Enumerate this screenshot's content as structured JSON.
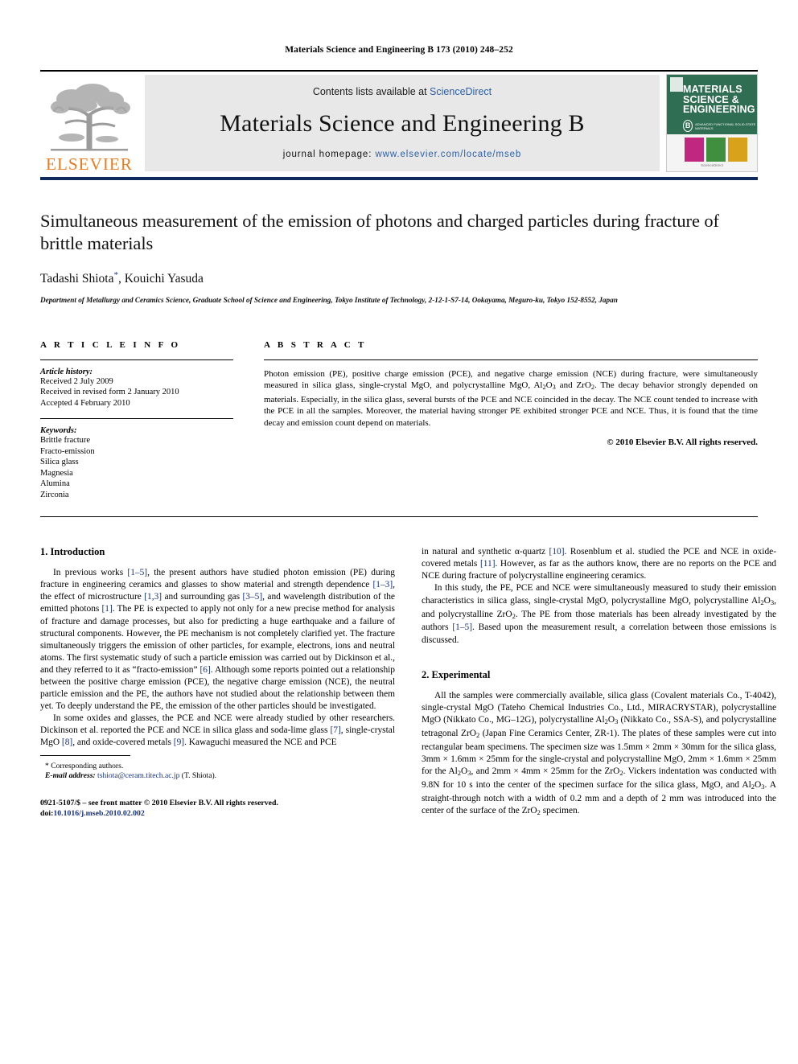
{
  "running_head": "Materials Science and Engineering B 173 (2010) 248–252",
  "masthead": {
    "publisher_name": "ELSEVIER",
    "contents_prefix": "Contents lists available at ",
    "contents_link": "ScienceDirect",
    "journal_title": "Materials Science and Engineering B",
    "homepage_prefix": "journal homepage: ",
    "homepage_url": "www.elsevier.com/locate/mseb",
    "cover": {
      "line1": "MATERIALS",
      "line2": "SCIENCE &",
      "line3": "ENGINEERING",
      "badge_letter": "B",
      "badge_text": "ADVANCED FUNCTIONAL SOLID-STATE MATERIALS",
      "footer_text": "ScienceDirect"
    }
  },
  "article": {
    "title": "Simultaneous measurement of the emission of photons and charged particles during fracture of brittle materials",
    "authors": "Tadashi Shiota",
    "authors_star": "*",
    "authors_rest": ", Kouichi Yasuda",
    "affiliation": "Department of Metallurgy and Ceramics Science, Graduate School of Science and Engineering, Tokyo Institute of Technology, 2-12-1-S7-14, Ookayama, Meguro-ku, Tokyo 152-8552, Japan"
  },
  "article_info": {
    "heading": "A R T I C L E  I N F O",
    "history_label": "Article history:",
    "history": [
      "Received 2 July 2009",
      "Received in revised form 2 January 2010",
      "Accepted 4 February 2010"
    ],
    "keywords_label": "Keywords:",
    "keywords": [
      "Brittle fracture",
      "Fracto-emission",
      "Silica glass",
      "Magnesia",
      "Alumina",
      "Zirconia"
    ]
  },
  "abstract": {
    "heading": "A B S T R A C T",
    "text_part1": "Photon emission (PE), positive charge emission (PCE), and negative charge emission (NCE) during fracture, were simultaneously measured in silica glass, single-crystal MgO, and polycrystalline MgO, Al",
    "text_part2": "O",
    "text_part3": " and ZrO",
    "text_part4": ". The decay behavior strongly depended on materials. Especially, in the silica glass, several bursts of the PCE and NCE coincided in the decay. The NCE count tended to increase with the PCE in all the samples. Moreover, the material having stronger PE exhibited stronger PCE and NCE. Thus, it is found that the time decay and emission count depend on materials.",
    "copyright": "© 2010 Elsevier B.V. All rights reserved."
  },
  "sections": {
    "introduction_heading": "1.  Introduction",
    "intro_p1_a": "In previous works ",
    "intro_p1_r1": "[1–5]",
    "intro_p1_b": ", the present authors have studied photon emission (PE) during fracture in engineering ceramics and glasses to show material and strength dependence ",
    "intro_p1_r2": "[1–3]",
    "intro_p1_c": ", the effect of microstructure ",
    "intro_p1_r3": "[1,3]",
    "intro_p1_d": " and surrounding gas ",
    "intro_p1_r4": "[3–5]",
    "intro_p1_e": ", and wavelength distribution of the emitted photons ",
    "intro_p1_r5": "[1]",
    "intro_p1_f": ". The PE is expected to apply not only for a new precise method for analysis of fracture and damage processes, but also for predicting a huge earthquake and a failure of structural components. However, the PE mechanism is not completely clarified yet. The fracture simultaneously triggers the emission of other particles, for example, electrons, ions and neutral atoms. The first systematic study of such a particle emission was carried out by Dickinson et al., and they referred to it as “fracto-emission” ",
    "intro_p1_r6": "[6]",
    "intro_p1_g": ". Although some reports pointed out a relationship between the positive charge emission (PCE), the negative charge emission (NCE), the neutral particle emission and the PE, the authors have not studied about the relationship between them yet. To deeply understand the PE, the emission of the other particles should be investigated.",
    "intro_p2_a": "In some oxides and glasses, the PCE and NCE were already studied by other researchers. Dickinson et al. reported the PCE and NCE in silica glass and soda-lime glass ",
    "intro_p2_r1": "[7]",
    "intro_p2_b": ", single-crystal MgO ",
    "intro_p2_r2": "[8]",
    "intro_p2_c": ", and oxide-covered metals ",
    "intro_p2_r3": "[9]",
    "intro_p2_d": ". Kawaguchi measured the NCE and PCE",
    "intro_p3_a": "in natural and synthetic α-quartz ",
    "intro_p3_r1": "[10]",
    "intro_p3_b": ". Rosenblum et al. studied the PCE and NCE in oxide-covered metals ",
    "intro_p3_r2": "[11]",
    "intro_p3_c": ". However, as far as the authors know, there are no reports on the PCE and NCE during fracture of polycrystalline engineering ceramics.",
    "intro_p4_a": "In this study, the PE, PCE and NCE were simultaneously measured to study their emission characteristics in silica glass, single-crystal MgO, polycrystalline MgO, polycrystalline Al",
    "intro_p4_b": "O",
    "intro_p4_c": ", and polycrystalline ZrO",
    "intro_p4_d": ". The PE from those materials has been already investigated by the authors ",
    "intro_p4_r1": "[1–5]",
    "intro_p4_e": ". Based upon the measurement result, a correlation between those emissions is discussed.",
    "experimental_heading": "2.  Experimental",
    "exp_p1_a": "All the samples were commercially available, silica glass (Covalent materials Co., T-4042), single-crystal MgO (Tateho Chemical Industries Co., Ltd., MIRACRYSTAR), polycrystalline MgO (Nikkato Co., MG–12G), polycrystalline Al",
    "exp_p1_b": "O",
    "exp_p1_c": " (Nikkato Co., SSA-S), and polycrystalline tetragonal ZrO",
    "exp_p1_d": " (Japan Fine Ceramics Center, ZR-1). The plates of these samples were cut into rectangular beam specimens. The specimen size was 1.5mm × 2mm × 30mm for the silica glass, 3mm × 1.6mm × 25mm for the single-crystal and polycrystalline MgO, 2mm × 1.6mm × 25mm for the Al",
    "exp_p1_e": "O",
    "exp_p1_f": ", and 2mm × 4mm × 25mm for the ZrO",
    "exp_p1_g": ". Vickers indentation was conducted with 9.8N for 10 s into the center of the specimen surface for the silica glass, MgO, and Al",
    "exp_p1_h": "O",
    "exp_p1_i": ". A straight-through notch with a width of 0.2 mm and a depth of 2 mm was introduced into the center of the surface of the ZrO",
    "exp_p1_j": " specimen."
  },
  "footnotes": {
    "corresponding": "* Corresponding authors.",
    "email_label": "E-mail address:",
    "email": "tshiota@ceram.titech.ac.jp",
    "email_suffix": " (T. Shiota).",
    "imprint_line1": "0921-5107/$ – see front matter © 2010 Elsevier B.V. All rights reserved.",
    "imprint_doi_label": "doi:",
    "imprint_doi": "10.1016/j.mseb.2010.02.002"
  },
  "subscripts": {
    "two": "2",
    "three": "3"
  },
  "colors": {
    "link": "#17317f",
    "elsevier_orange": "#E87B1E",
    "masthead_rule": "#0f2b5b",
    "masthead_bg": "#e8e8e8"
  }
}
